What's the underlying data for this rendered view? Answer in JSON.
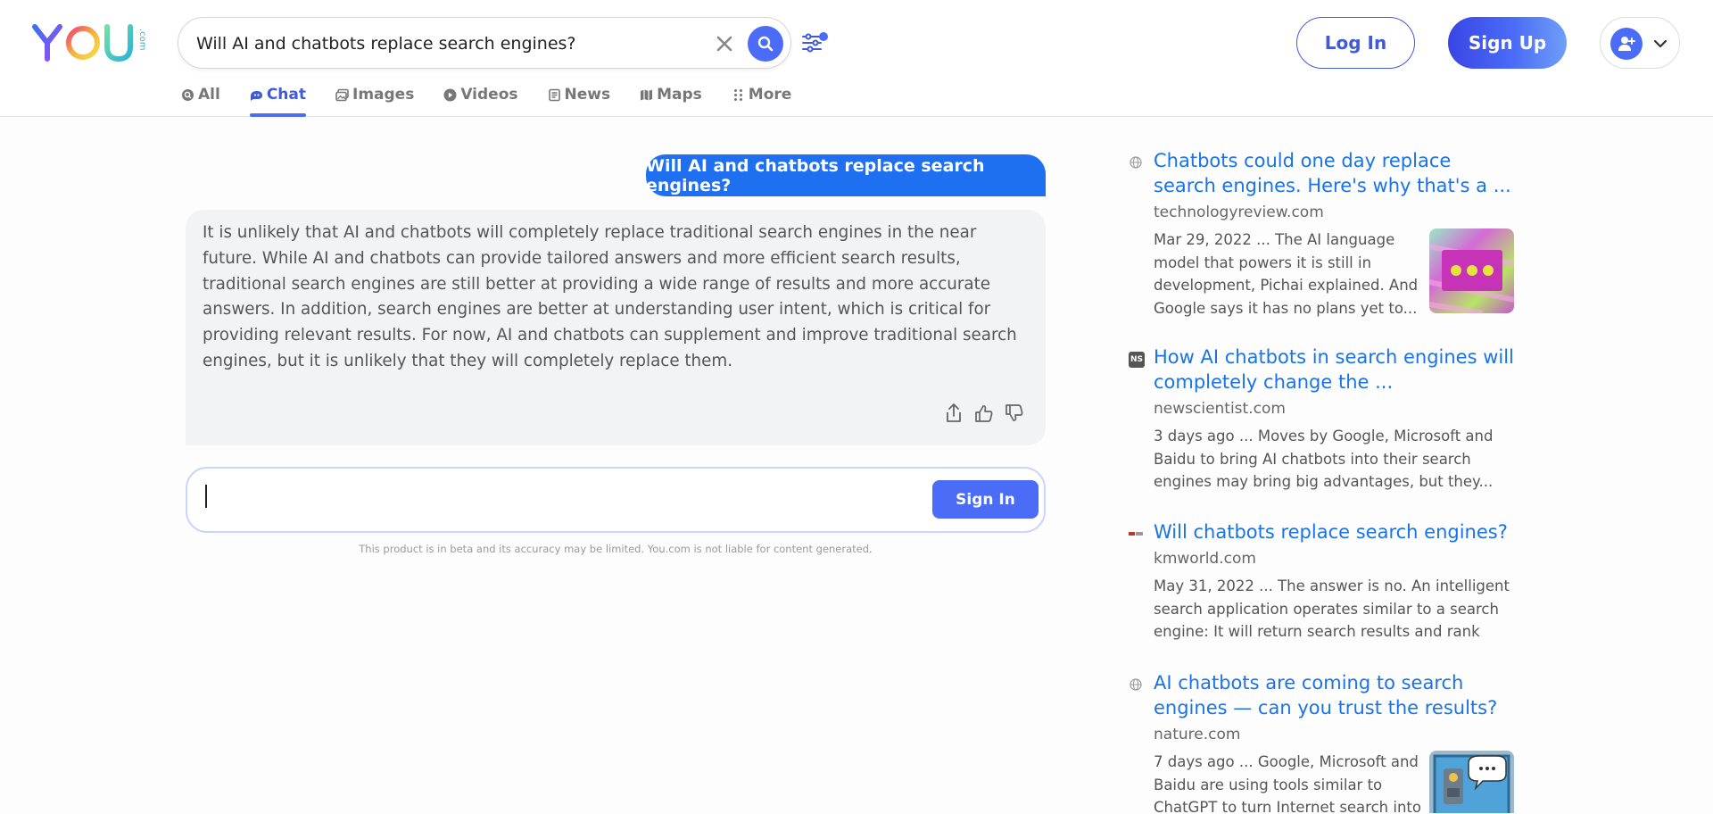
{
  "header": {
    "logo_text": "YOU",
    "logo_suffix": ".com",
    "search": {
      "value": "Will AI and chatbots replace search engines?"
    },
    "login_label": "Log In",
    "signup_label": "Sign Up"
  },
  "tabs": [
    {
      "label": "All",
      "icon": "search-icon"
    },
    {
      "label": "Chat",
      "icon": "chat-icon",
      "active": true
    },
    {
      "label": "Images",
      "icon": "images-icon"
    },
    {
      "label": "Videos",
      "icon": "play-icon"
    },
    {
      "label": "News",
      "icon": "news-icon"
    },
    {
      "label": "Maps",
      "icon": "map-icon"
    },
    {
      "label": "More",
      "icon": "dots-grid-icon"
    }
  ],
  "chat": {
    "user_message": "Will AI and chatbots replace search engines?",
    "bot_response": "It is unlikely that AI and chatbots will completely replace traditional search engines in the near future. While AI and chatbots can provide tailored answers and more efficient search results, traditional search engines are still better at providing a wide range of results and more accurate answers. In addition, search engines are better at understanding user intent, which is critical for providing relevant results. For now, AI and chatbots can supplement and improve traditional search engines, but it is unlikely that they will completely replace them.",
    "composer_value": "",
    "signin_label": "Sign In",
    "disclaimer": "This product is in beta and its accuracy may be limited. You.com is not liable for content generated."
  },
  "results": [
    {
      "title": "Chatbots could one day replace search engines. Here's why that's a ...",
      "domain": "technologyreview.com",
      "snippet": "Mar 29, 2022 ... The AI language model that powers it is still in development, Pichai explained. And Google says it has no plans yet to...",
      "favicon": "globe-icon",
      "has_thumb": true
    },
    {
      "title": "How AI chatbots in search engines will completely change the ...",
      "domain": "newscientist.com",
      "snippet": "3 days ago ... Moves by Google, Microsoft and Baidu to bring AI chatbots into their search engines may bring big advantages, but they...",
      "favicon": "ns-logo-icon",
      "favicon_text": "NS",
      "has_thumb": false
    },
    {
      "title": "Will chatbots replace search engines?",
      "domain": "kmworld.com",
      "snippet": "May 31, 2022 ... The answer is no. An intelligent search application operates similar to a search engine: It will return search results and rank the...",
      "favicon": "kmworld-logo-icon",
      "has_thumb": false
    },
    {
      "title": "AI chatbots are coming to search engines — can you trust the results?",
      "domain": "nature.com",
      "snippet": "7 days ago ... Google, Microsoft and Baidu are using tools similar to ChatGPT to turn Internet search into",
      "favicon": "globe-icon",
      "has_thumb": true
    }
  ],
  "colors": {
    "accent": "#4a6cf7",
    "user_bubble": "#1f6ff1",
    "link": "#1a73e8"
  }
}
